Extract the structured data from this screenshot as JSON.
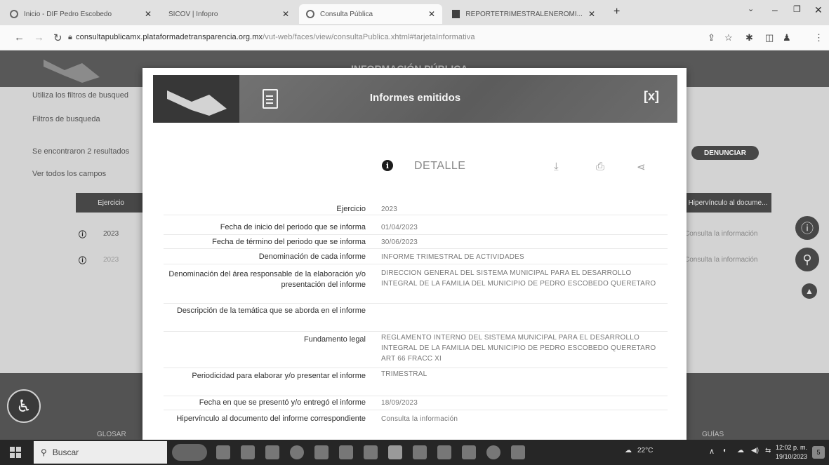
{
  "browser": {
    "tabs": [
      {
        "title": "Inicio - DIF Pedro Escobedo"
      },
      {
        "title": "SICOV | Infopro"
      },
      {
        "title": "Consulta Pública"
      },
      {
        "title": "REPORTETRIMESTRALENEROMI..."
      }
    ],
    "new_tab": "+",
    "url_host": "consultapublicamx.plataformadetransparencia.org.mx",
    "url_path": "/vut-web/faces/view/consultaPublica.xhtml#tarjetaInformativa"
  },
  "background": {
    "menu_title": "INFORMACIÓN PÚBLICA",
    "filters_hint": "Utiliza los filtros de busqued",
    "filters_toggle": "Filtros de busqueda",
    "results_text": "Se encontraron 2 resultados",
    "see_all": "Ver todos los campos",
    "col_ejercicio": "Ejercicio",
    "col_hipervinculo": "Hipervínculo al docume...",
    "row1_year": "2023",
    "row2_year": "2023",
    "row1_link": "Consulta la información",
    "row2_link": "Consulta la información",
    "denunciar": "DENUNCIAR",
    "footer_glosario": "GLOSAR",
    "footer_guias": "GUÍAS"
  },
  "modal": {
    "title": "Informes emitidos",
    "close_label": "[x]",
    "detail_label": "DETALLE",
    "fields": [
      {
        "label": "Ejercicio",
        "value": "2023"
      },
      {
        "label": "Fecha de inicio del periodo que se informa",
        "value": "01/04/2023"
      },
      {
        "label": "Fecha de término del periodo que se informa",
        "value": "30/06/2023"
      },
      {
        "label": "Denominación de cada informe",
        "value": "INFORME TRIMESTRAL DE ACTIVIDADES"
      },
      {
        "label": "Denominación del área responsable de la elaboración y/o presentación del informe",
        "value": "DIRECCION GENERAL DEL SISTEMA MUNICIPAL PARA EL DESARROLLO INTEGRAL DE LA FAMILIA DEL MUNICIPIO DE PEDRO ESCOBEDO QUERETARO"
      },
      {
        "label": "Descripción de la temática que se aborda en el informe",
        "value": ""
      },
      {
        "label": "Fundamento legal",
        "value": "REGLAMENTO INTERNO DEL SISTEMA MUNICIPAL PARA EL DESARROLLO INTEGRAL DE LA FAMILIA DEL MUNICIPIO DE PEDRO ESCOBEDO QUERETARO ART 66 FRACC XI"
      },
      {
        "label": "Periodicidad para elaborar y/o presentar el informe",
        "value": "TRIMESTRAL"
      },
      {
        "label": "Fecha en que se presentó y/o entregó el informe",
        "value": "18/09/2023"
      },
      {
        "label": "Hipervínculo al documento del informe correspondiente",
        "value": "Consulta la información"
      }
    ]
  },
  "taskbar": {
    "search_placeholder": "Buscar",
    "temperature": "22°C",
    "time": "12:02 p. m.",
    "date": "19/10/2023",
    "notifications": "5"
  }
}
